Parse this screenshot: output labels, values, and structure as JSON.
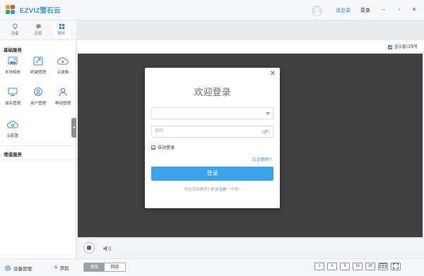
{
  "app": {
    "brand_text": "EZVIZ萤石云"
  },
  "titlebar": {
    "login_link": "请登录",
    "menu_label": "菜单",
    "minimize_glyph": "–",
    "maximize_glyph": "▫",
    "close_glyph": "✕"
  },
  "navtabs": [
    {
      "label": "设备",
      "icon": "device-icon"
    },
    {
      "label": "消息",
      "icon": "message-icon"
    },
    {
      "label": "服务",
      "icon": "apps-icon",
      "active": true
    }
  ],
  "sidebar": {
    "basic_services_title": "基础服务",
    "value_added_title": "增值服务",
    "services": [
      {
        "label": "本地相册",
        "icon": "album-icon"
      },
      {
        "label": "终端管理",
        "icon": "terminal-icon"
      },
      {
        "label": "云录像",
        "icon": "cloud-record-icon"
      },
      {
        "label": "域名管理",
        "icon": "monitor-icon"
      },
      {
        "label": "用户管理",
        "icon": "user-icon"
      },
      {
        "label": "群组管理",
        "icon": "group-icon"
      },
      {
        "label": "云配置",
        "icon": "cloud-config-icon"
      }
    ],
    "collapse_glyph": "◂"
  },
  "toolbar": {
    "show_window_index_label": "显示窗口序号",
    "show_window_index_checked": true
  },
  "login_modal": {
    "title": "欢迎登录",
    "account_placeholder": "",
    "password_placeholder": "密码",
    "auto_login_label": "自动登录",
    "auto_login_checked": true,
    "forgot_password": "忘记密码?",
    "login_button": "登录",
    "register_prefix": "你还没有账号? 那就",
    "register_link": "注册",
    "register_suffix": "一个吧~",
    "close_glyph": "✕"
  },
  "bottombar": {
    "device_manage": "设备管理",
    "add_label": "添加",
    "mode_tabs": [
      {
        "label": "预览",
        "active": true
      },
      {
        "label": "回放",
        "active": false
      }
    ],
    "layouts": [
      "1",
      "4",
      "9",
      "16",
      "25",
      "",
      ""
    ]
  },
  "colors": {
    "accent": "#2e8ae6",
    "login_button": "#3aa3ee",
    "video_background": "#414141"
  }
}
